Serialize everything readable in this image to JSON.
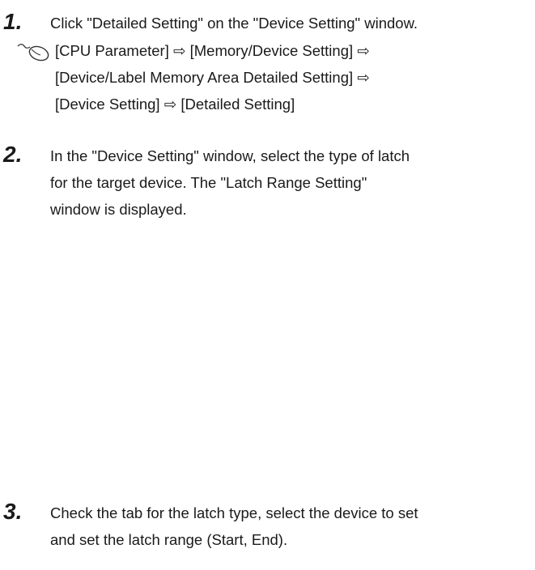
{
  "steps": [
    {
      "number": "1.",
      "lines": [
        "Click \"Detailed Setting\" on the \"Device Setting\" window."
      ]
    },
    {
      "number": "2.",
      "lines": [
        "In the \"Device Setting\" window, select the type of latch",
        "for the target device. The \"Latch Range Setting\"",
        "window is displayed."
      ]
    },
    {
      "number": "3.",
      "lines": [
        "Check the tab for the latch type, select the device to set",
        "and set the latch range (Start, End)."
      ]
    }
  ],
  "navigation": {
    "icon": "mouse-icon",
    "lines": [
      "[CPU Parameter] ⇨ [Memory/Device Setting] ⇨",
      "[Device/Label Memory Area Detailed Setting] ⇨",
      "[Device Setting] ⇨ [Detailed Setting]"
    ]
  }
}
